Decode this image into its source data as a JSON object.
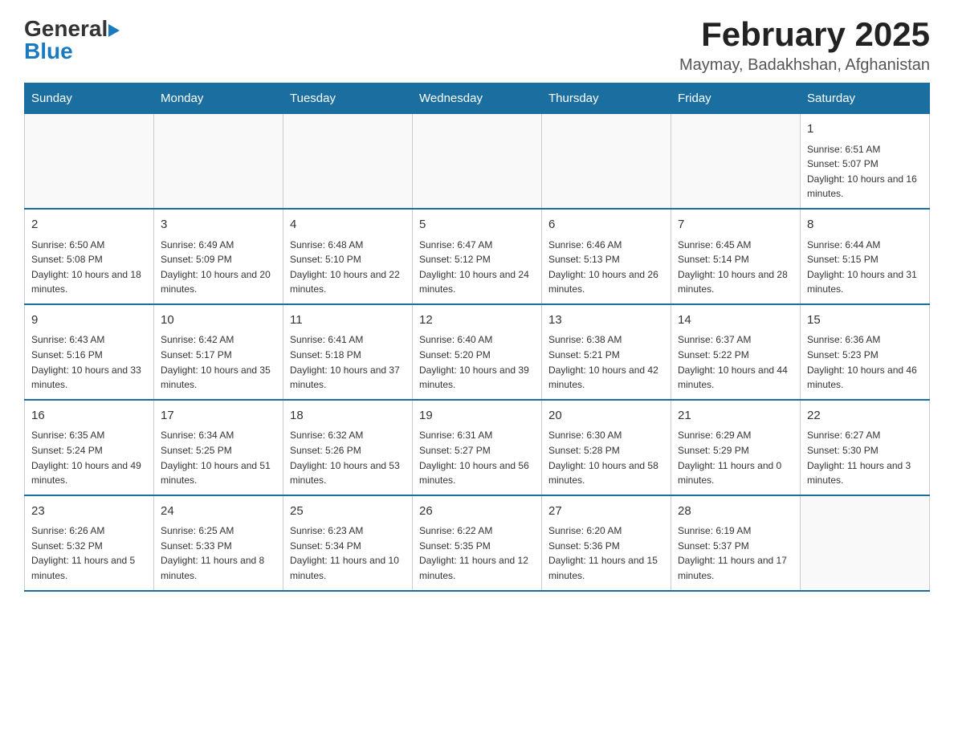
{
  "logo": {
    "general": "General",
    "arrow": "▶",
    "blue": "Blue"
  },
  "title": "February 2025",
  "subtitle": "Maymay, Badakhshan, Afghanistan",
  "weekdays": [
    "Sunday",
    "Monday",
    "Tuesday",
    "Wednesday",
    "Thursday",
    "Friday",
    "Saturday"
  ],
  "weeks": [
    [
      {
        "day": "",
        "info": ""
      },
      {
        "day": "",
        "info": ""
      },
      {
        "day": "",
        "info": ""
      },
      {
        "day": "",
        "info": ""
      },
      {
        "day": "",
        "info": ""
      },
      {
        "day": "",
        "info": ""
      },
      {
        "day": "1",
        "info": "Sunrise: 6:51 AM\nSunset: 5:07 PM\nDaylight: 10 hours and 16 minutes."
      }
    ],
    [
      {
        "day": "2",
        "info": "Sunrise: 6:50 AM\nSunset: 5:08 PM\nDaylight: 10 hours and 18 minutes."
      },
      {
        "day": "3",
        "info": "Sunrise: 6:49 AM\nSunset: 5:09 PM\nDaylight: 10 hours and 20 minutes."
      },
      {
        "day": "4",
        "info": "Sunrise: 6:48 AM\nSunset: 5:10 PM\nDaylight: 10 hours and 22 minutes."
      },
      {
        "day": "5",
        "info": "Sunrise: 6:47 AM\nSunset: 5:12 PM\nDaylight: 10 hours and 24 minutes."
      },
      {
        "day": "6",
        "info": "Sunrise: 6:46 AM\nSunset: 5:13 PM\nDaylight: 10 hours and 26 minutes."
      },
      {
        "day": "7",
        "info": "Sunrise: 6:45 AM\nSunset: 5:14 PM\nDaylight: 10 hours and 28 minutes."
      },
      {
        "day": "8",
        "info": "Sunrise: 6:44 AM\nSunset: 5:15 PM\nDaylight: 10 hours and 31 minutes."
      }
    ],
    [
      {
        "day": "9",
        "info": "Sunrise: 6:43 AM\nSunset: 5:16 PM\nDaylight: 10 hours and 33 minutes."
      },
      {
        "day": "10",
        "info": "Sunrise: 6:42 AM\nSunset: 5:17 PM\nDaylight: 10 hours and 35 minutes."
      },
      {
        "day": "11",
        "info": "Sunrise: 6:41 AM\nSunset: 5:18 PM\nDaylight: 10 hours and 37 minutes."
      },
      {
        "day": "12",
        "info": "Sunrise: 6:40 AM\nSunset: 5:20 PM\nDaylight: 10 hours and 39 minutes."
      },
      {
        "day": "13",
        "info": "Sunrise: 6:38 AM\nSunset: 5:21 PM\nDaylight: 10 hours and 42 minutes."
      },
      {
        "day": "14",
        "info": "Sunrise: 6:37 AM\nSunset: 5:22 PM\nDaylight: 10 hours and 44 minutes."
      },
      {
        "day": "15",
        "info": "Sunrise: 6:36 AM\nSunset: 5:23 PM\nDaylight: 10 hours and 46 minutes."
      }
    ],
    [
      {
        "day": "16",
        "info": "Sunrise: 6:35 AM\nSunset: 5:24 PM\nDaylight: 10 hours and 49 minutes."
      },
      {
        "day": "17",
        "info": "Sunrise: 6:34 AM\nSunset: 5:25 PM\nDaylight: 10 hours and 51 minutes."
      },
      {
        "day": "18",
        "info": "Sunrise: 6:32 AM\nSunset: 5:26 PM\nDaylight: 10 hours and 53 minutes."
      },
      {
        "day": "19",
        "info": "Sunrise: 6:31 AM\nSunset: 5:27 PM\nDaylight: 10 hours and 56 minutes."
      },
      {
        "day": "20",
        "info": "Sunrise: 6:30 AM\nSunset: 5:28 PM\nDaylight: 10 hours and 58 minutes."
      },
      {
        "day": "21",
        "info": "Sunrise: 6:29 AM\nSunset: 5:29 PM\nDaylight: 11 hours and 0 minutes."
      },
      {
        "day": "22",
        "info": "Sunrise: 6:27 AM\nSunset: 5:30 PM\nDaylight: 11 hours and 3 minutes."
      }
    ],
    [
      {
        "day": "23",
        "info": "Sunrise: 6:26 AM\nSunset: 5:32 PM\nDaylight: 11 hours and 5 minutes."
      },
      {
        "day": "24",
        "info": "Sunrise: 6:25 AM\nSunset: 5:33 PM\nDaylight: 11 hours and 8 minutes."
      },
      {
        "day": "25",
        "info": "Sunrise: 6:23 AM\nSunset: 5:34 PM\nDaylight: 11 hours and 10 minutes."
      },
      {
        "day": "26",
        "info": "Sunrise: 6:22 AM\nSunset: 5:35 PM\nDaylight: 11 hours and 12 minutes."
      },
      {
        "day": "27",
        "info": "Sunrise: 6:20 AM\nSunset: 5:36 PM\nDaylight: 11 hours and 15 minutes."
      },
      {
        "day": "28",
        "info": "Sunrise: 6:19 AM\nSunset: 5:37 PM\nDaylight: 11 hours and 17 minutes."
      },
      {
        "day": "",
        "info": ""
      }
    ]
  ]
}
